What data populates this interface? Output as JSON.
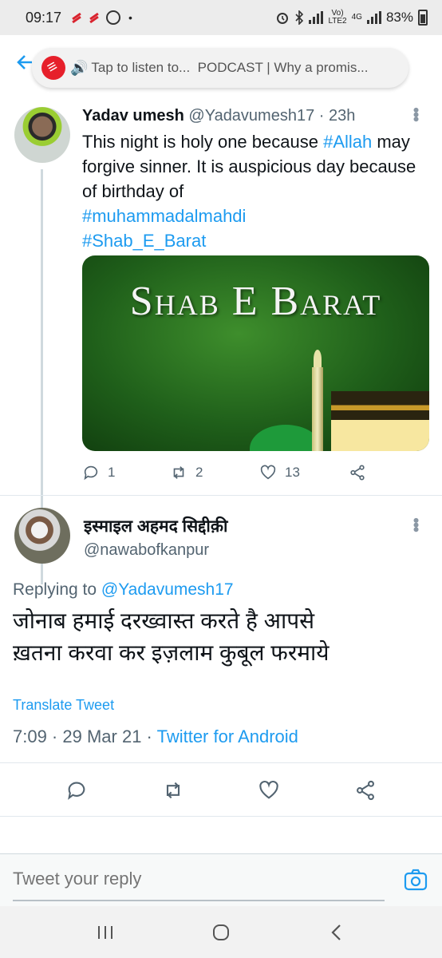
{
  "status_bar": {
    "time": "09:17",
    "network_top": "Vo)",
    "network_bottom": "LTE2",
    "net_type": "4G",
    "battery": "83%"
  },
  "header": {
    "podcast_prompt": "Tap to listen to...",
    "podcast_title": "PODCAST | Why a promis..."
  },
  "tweet": {
    "author_name": "Yadav umesh",
    "author_handle": "@Yadavumesh17",
    "time_ago": "· 23h",
    "text_pre": "This night is holy one because ",
    "hashtag1": "#Allah",
    "text_post": " may forgive sinner. It is auspicious day because of birthday of",
    "hashtag2": "#muhammadalmahdi",
    "hashtag3": "#Shab_E_Barat",
    "image_text": "Shab E Barat",
    "replies": "1",
    "retweets": "2",
    "likes": "13"
  },
  "reply": {
    "author_name": "इस्माइल अहमद सिद्दीक़ी",
    "author_handle": "@nawabofkanpur",
    "replying_prefix": "Replying to",
    "replying_to": "@Yadavumesh17",
    "text_line1": "जोनाब हमाई दरख्वास्त करते है आपसे",
    "text_line2": "ख़तना करवा कर इज़लाम कुबूल फरमाये",
    "translate": "Translate Tweet",
    "timestamp": "7:09 · 29 Mar 21 ·",
    "source": "Twitter for Android"
  },
  "reply_bar": {
    "placeholder": "Tweet your reply"
  },
  "colors": {
    "accent": "#1d9bf0",
    "secondary_text": "#536471",
    "podcast_red": "#e6202b"
  }
}
